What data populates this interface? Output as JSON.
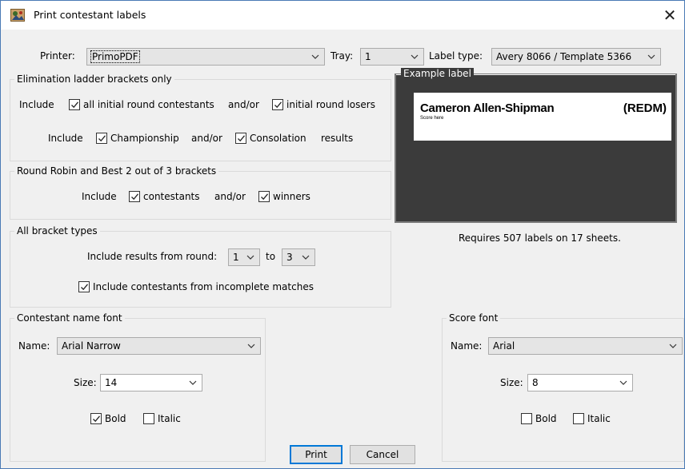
{
  "window": {
    "title": "Print contestant labels",
    "close_glyph": "✕"
  },
  "top": {
    "printer_label": "Printer:",
    "printer_value": "PrimoPDF",
    "tray_label": "Tray:",
    "tray_value": "1",
    "label_type_label": "Label type:",
    "label_type_value": "Avery 8066 / Template 5366"
  },
  "elimination": {
    "title": "Elimination ladder brackets only",
    "include1": "Include",
    "all_initial": "all initial round contestants",
    "andor1": "and/or",
    "initial_losers": "initial round losers",
    "include2": "Include",
    "championship": "Championship",
    "andor2": "and/or",
    "consolation": "Consolation",
    "results": "results",
    "all_initial_checked": true,
    "initial_losers_checked": true,
    "championship_checked": true,
    "consolation_checked": true
  },
  "roundrobin": {
    "title": "Round Robin and Best 2 out of 3 brackets",
    "include": "Include",
    "contestants": "contestants",
    "andor": "and/or",
    "winners": "winners",
    "contestants_checked": true,
    "winners_checked": true
  },
  "allbrackets": {
    "title": "All bracket types",
    "include_results_label": "Include results from round:",
    "from_value": "1",
    "to_label": "to",
    "to_value": "3",
    "incomplete_label": "Include contestants from incomplete matches",
    "incomplete_checked": true
  },
  "example": {
    "title": "Example label",
    "name": "Cameron Allen-Shipman",
    "club": "(REDM)",
    "score": "Score here"
  },
  "requires_text": "Requires 507 labels on 17 sheets.",
  "name_font": {
    "title": "Contestant name font",
    "name_label": "Name:",
    "name_value": "Arial Narrow",
    "size_label": "Size:",
    "size_value": "14",
    "bold_label": "Bold",
    "italic_label": "Italic",
    "bold_checked": true,
    "italic_checked": false
  },
  "score_font": {
    "title": "Score font",
    "name_label": "Name:",
    "name_value": "Arial",
    "size_label": "Size:",
    "size_value": "8",
    "bold_label": "Bold",
    "italic_label": "Italic",
    "bold_checked": false,
    "italic_checked": false
  },
  "buttons": {
    "print": "Print",
    "cancel": "Cancel"
  },
  "colors": {
    "accent": "#0078d7",
    "preview_bg": "#3b3b3b"
  }
}
